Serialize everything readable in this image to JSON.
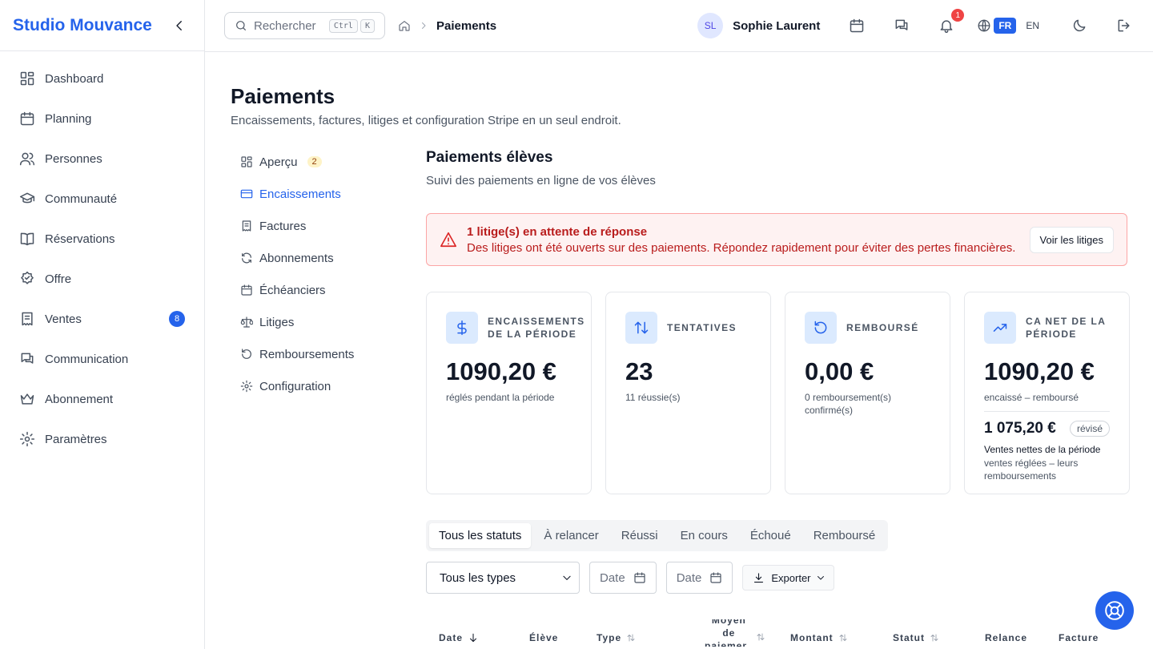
{
  "brand": {
    "name": "Studio Mouvance"
  },
  "sidebar": {
    "items": [
      {
        "label": "Dashboard",
        "icon": "dashboard-icon"
      },
      {
        "label": "Planning",
        "icon": "calendar-icon"
      },
      {
        "label": "Personnes",
        "icon": "users-icon"
      },
      {
        "label": "Communauté",
        "icon": "community-icon"
      },
      {
        "label": "Réservations",
        "icon": "book-icon"
      },
      {
        "label": "Offre",
        "icon": "badge-icon"
      },
      {
        "label": "Ventes",
        "icon": "receipt-icon",
        "badge": "8"
      },
      {
        "label": "Communication",
        "icon": "chat-icon"
      },
      {
        "label": "Abonnement",
        "icon": "crown-icon"
      },
      {
        "label": "Paramètres",
        "icon": "gear-icon"
      }
    ]
  },
  "topbar": {
    "search_placeholder": "Rechercher",
    "kbd": [
      "Ctrl",
      "K"
    ],
    "breadcrumb": "Paiements",
    "user_initials": "SL",
    "user_name": "Sophie Laurent",
    "notif_count": "1",
    "lang_fr": "FR",
    "lang_en": "EN"
  },
  "page": {
    "title": "Paiements",
    "subtitle": "Encaissements, factures, litiges et configuration Stripe en un seul endroit."
  },
  "subnav": {
    "items": [
      {
        "label": "Aperçu",
        "badge": "2"
      },
      {
        "label": "Encaissements",
        "active": true
      },
      {
        "label": "Factures"
      },
      {
        "label": "Abonnements"
      },
      {
        "label": "Échéanciers"
      },
      {
        "label": "Litiges"
      },
      {
        "label": "Remboursements"
      },
      {
        "label": "Configuration"
      }
    ]
  },
  "section": {
    "title": "Paiements élèves",
    "subtitle": "Suivi des paiements en ligne de vos élèves"
  },
  "alert": {
    "title": "1 litige(s) en attente de réponse",
    "text": "Des litiges ont été ouverts sur des paiements. Répondez rapidement pour éviter des pertes financières.",
    "button": "Voir les litiges"
  },
  "cards": [
    {
      "label": "Encaissements de la période",
      "value": "1090,20 €",
      "note": "réglés pendant la période"
    },
    {
      "label": "Tentatives",
      "value": "23",
      "note": "11 réussie(s)"
    },
    {
      "label": "Remboursé",
      "value": "0,00 €",
      "note": "0 remboursement(s) confirmé(s)"
    },
    {
      "label": "CA net de la période",
      "value": "1090,20 €",
      "note": "encaissé – remboursé",
      "value2": "1 075,20 €",
      "pill": "révisé",
      "note2": "Ventes nettes de la période",
      "note3": "ventes réglées – leurs remboursements"
    }
  ],
  "tabs": [
    "Tous les statuts",
    "À relancer",
    "Réussi",
    "En cours",
    "Échoué",
    "Remboursé"
  ],
  "filters": {
    "type_select": "Tous les types",
    "date_from": "Date",
    "date_to": "Date",
    "export": "Exporter"
  },
  "table": {
    "headers": [
      "Date",
      "Élève",
      "Type",
      "Moyen de paiement",
      "Montant",
      "Statut",
      "Relance",
      "Facture"
    ]
  },
  "colors": {
    "accent": "#2563eb",
    "danger": "#dc2626"
  }
}
